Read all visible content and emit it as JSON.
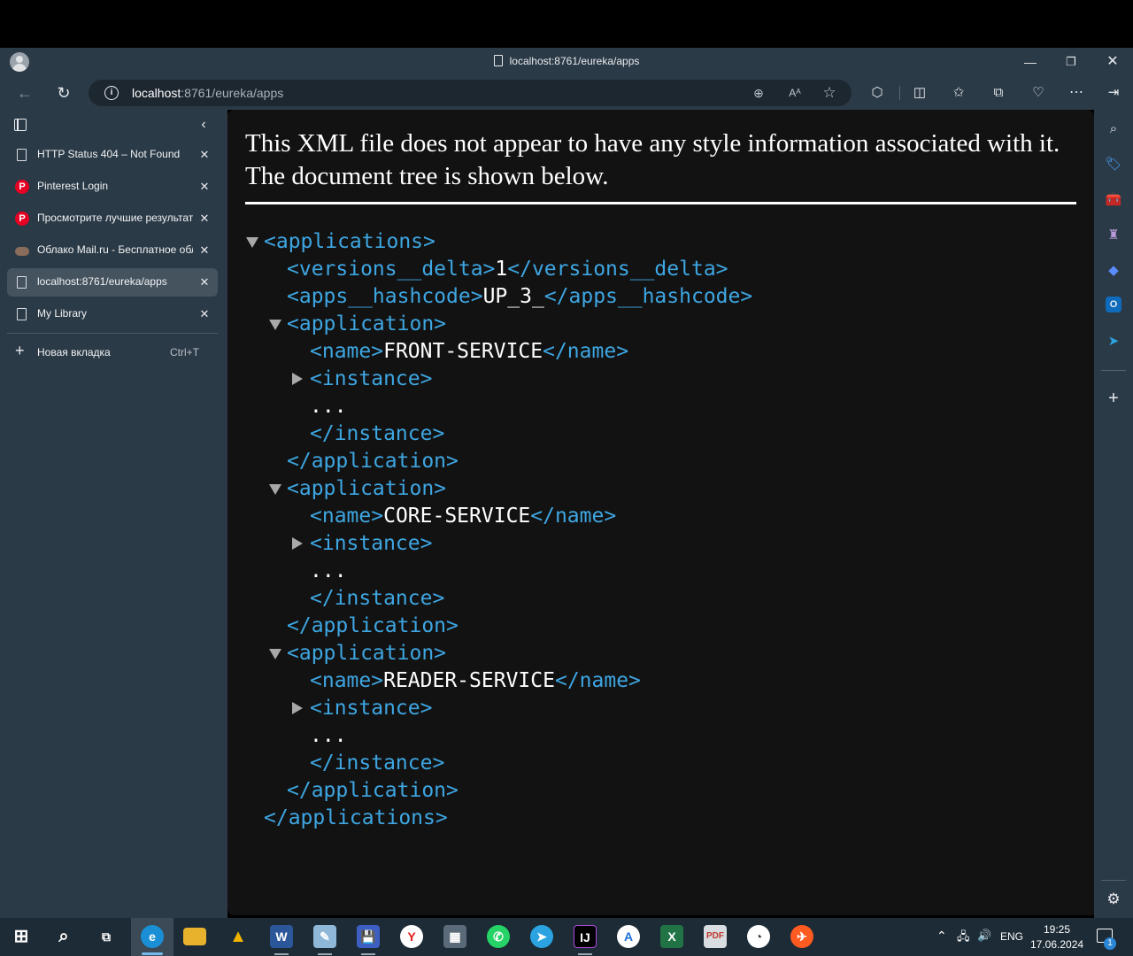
{
  "window": {
    "title": "localhost:8761/eureka/apps"
  },
  "address_bar": {
    "host": "localhost",
    "path": ":8761/eureka/apps"
  },
  "tabs": [
    {
      "label": "HTTP Status 404 – Not Found",
      "icon": "page-icon",
      "active": false
    },
    {
      "label": "Pinterest Login",
      "icon": "pinterest-icon",
      "active": false
    },
    {
      "label": "Просмотрите лучшие результаты",
      "icon": "pinterest-icon",
      "active": false
    },
    {
      "label": "Облако Mail.ru - Бесплатное облачное хранилище",
      "icon": "cloud-icon",
      "active": false
    },
    {
      "label": "localhost:8761/eureka/apps",
      "icon": "page-icon",
      "active": true
    },
    {
      "label": "My Library",
      "icon": "page-icon",
      "active": false
    }
  ],
  "new_tab": {
    "label": "Новая вкладка",
    "shortcut": "Ctrl+T"
  },
  "content": {
    "notice": "This XML file does not appear to have any style information associated with it. The document tree is shown below.",
    "xml": {
      "root_open": "<applications>",
      "root_close": "</applications>",
      "versions_open": "<versions__delta>",
      "versions_value": "1",
      "versions_close": "</versions__delta>",
      "hash_open": "<apps__hashcode>",
      "hash_value": "UP_3_",
      "hash_close": "</apps__hashcode>",
      "app_open": "<application>",
      "app_close": "</application>",
      "name_open": "<name>",
      "name_close": "</name>",
      "instance_open": "<instance>",
      "instance_close": "</instance>",
      "ellipsis": "...",
      "applications": [
        {
          "name": "FRONT-SERVICE"
        },
        {
          "name": "CORE-SERVICE"
        },
        {
          "name": "READER-SERVICE"
        }
      ]
    }
  },
  "taskbar": {
    "language": "ENG",
    "time": "19:25",
    "date": "17.06.2024",
    "notification_count": "1"
  }
}
